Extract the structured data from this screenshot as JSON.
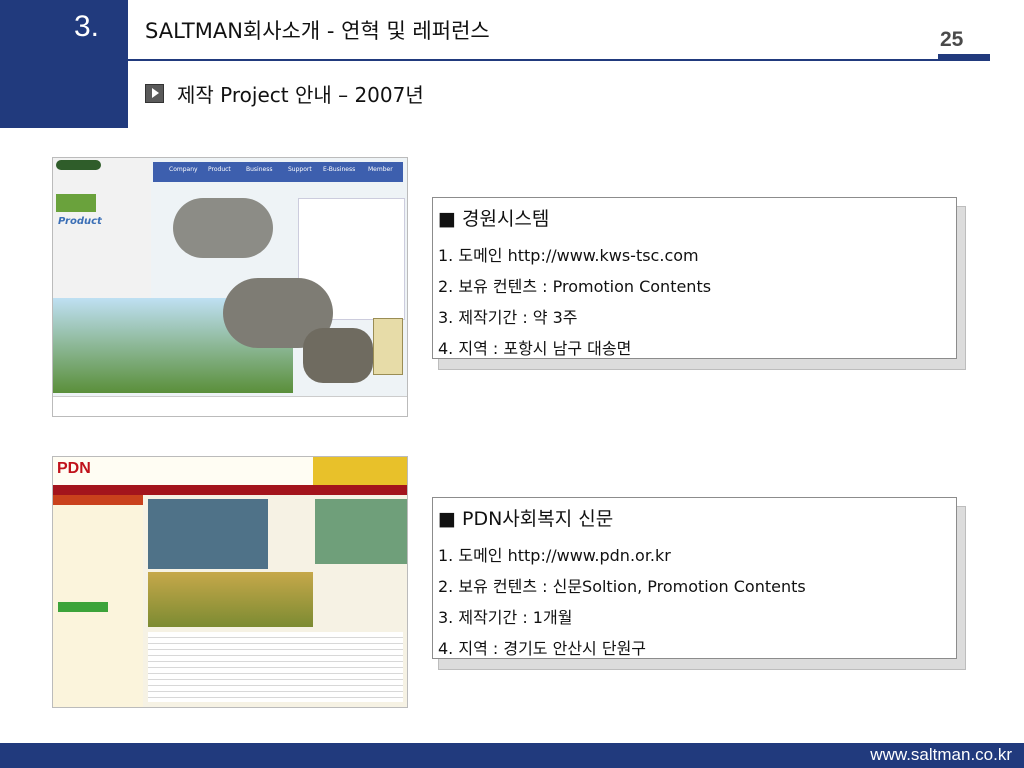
{
  "header": {
    "section_number": "3.",
    "title": "SALTMAN회사소개 - 연혁 및 레퍼런스",
    "page_number": "25",
    "subtitle": "제작 Project 안내 – 2007년"
  },
  "projects": [
    {
      "heading": "■ 경원시스템",
      "lines": [
        "1. 도메인 http://www.kws-tsc.com",
        "2. 보유 컨텐츠 : Promotion Contents",
        "3. 제작기간 : 약 3주",
        "4. 지역 : 포항시 남구 대송면"
      ],
      "screenshot": {
        "nav": [
          "Company",
          "Product",
          "Business",
          "Support",
          "E-Business",
          "Member"
        ],
        "brand": "Product"
      }
    },
    {
      "heading": "■ PDN사회복지 신문",
      "lines": [
        "1. 도메인 http://www.pdn.or.kr",
        "2. 보유 컨텐츠 : 신문Soltion, Promotion Contents",
        "3. 제작기간 : 1개월",
        "4. 지역 : 경기도 안산시 단원구"
      ],
      "screenshot": {
        "brand": "PDN"
      }
    }
  ],
  "footer": {
    "url": "www.saltman.co.kr"
  }
}
